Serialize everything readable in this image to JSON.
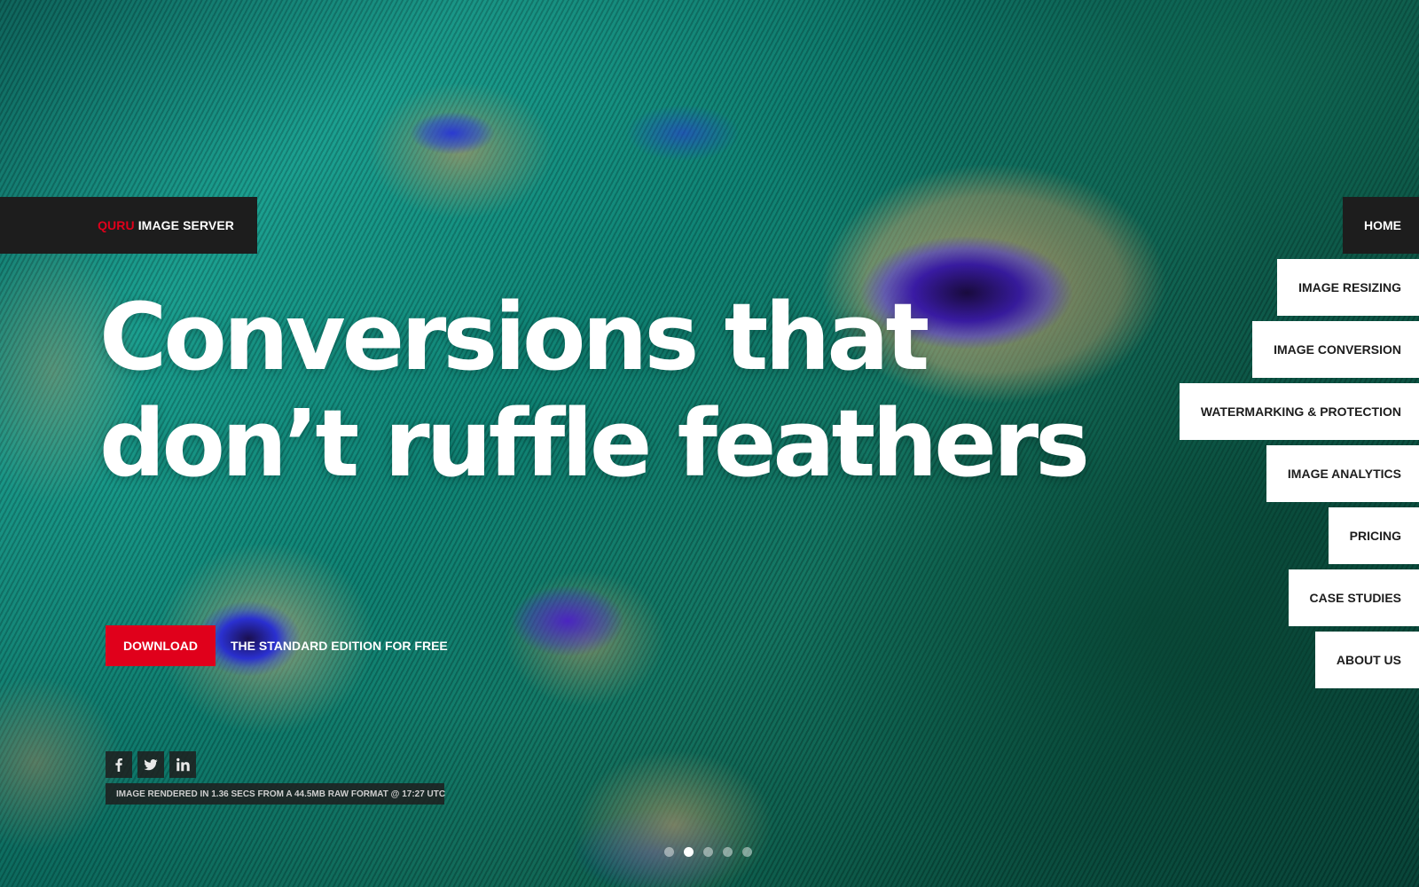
{
  "brand": {
    "prefix": "QURU",
    "name": "IMAGE SERVER"
  },
  "headline": {
    "line1": "Conversions that",
    "line2": "don’t ruffle feathers"
  },
  "cta": {
    "button_label": "DOWNLOAD",
    "text": "THE STANDARD EDITION FOR FREE"
  },
  "social": [
    {
      "name": "facebook-icon"
    },
    {
      "name": "twitter-icon"
    },
    {
      "name": "linkedin-icon"
    }
  ],
  "render_info": "IMAGE RENDERED IN 1.36 SECS FROM A 44.5MB RAW FORMAT @ 17:27 UTC",
  "carousel": {
    "slides": 5,
    "active_index": 1
  },
  "nav": {
    "items": [
      {
        "label": "HOME",
        "active": true
      },
      {
        "label": "IMAGE RESIZING"
      },
      {
        "label": "IMAGE CONVERSION"
      },
      {
        "label": "WATERMARKING & PROTECTION"
      },
      {
        "label": "IMAGE ANALYTICS"
      },
      {
        "label": "PRICING"
      },
      {
        "label": "CASE STUDIES"
      },
      {
        "label": "ABOUT US"
      }
    ]
  },
  "colors": {
    "accent": "#e0001b",
    "dark_bar": "#1d1d1d",
    "nav_bg": "#ffffff"
  }
}
